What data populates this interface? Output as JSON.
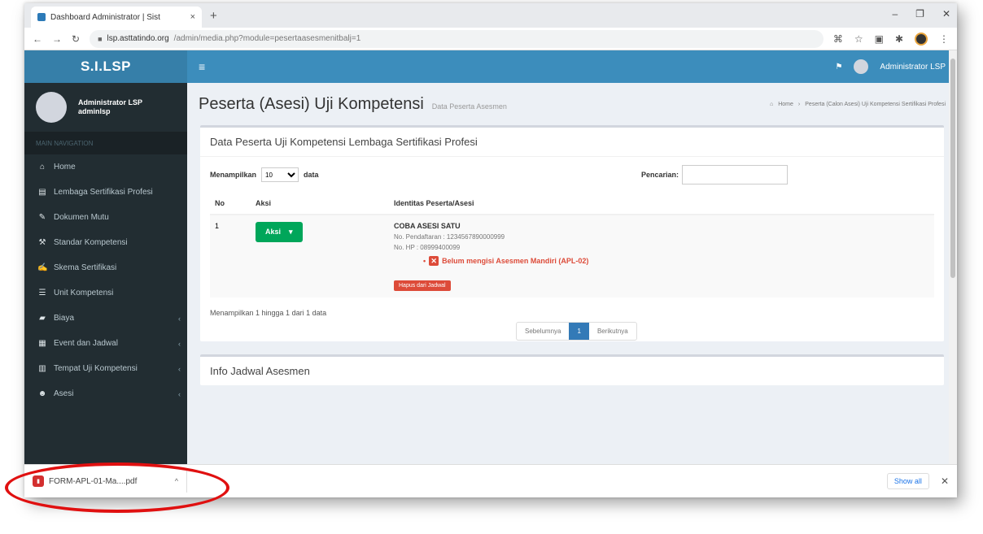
{
  "browser": {
    "tab_title": "Dashboard Administrator | Sist",
    "tab_close": "×",
    "new_tab": "+",
    "url_domain": "lsp.asttatindo.org",
    "url_path": "/admin/media.php?module=pesertaasesmenitbalj=1",
    "win_min": "–",
    "win_max": "❐",
    "win_close": "✕"
  },
  "app": {
    "logo": "S.I.LSP",
    "user_name": "Administrator LSP",
    "user_login": "adminlsp",
    "nav_header": "MAIN NAVIGATION",
    "nav": [
      {
        "icon": "home-icon",
        "glyph": "⌂",
        "label": "Home"
      },
      {
        "icon": "institution-icon",
        "glyph": "▤",
        "label": "Lembaga Sertifikasi Profesi"
      },
      {
        "icon": "document-icon",
        "glyph": "✎",
        "label": "Dokumen Mutu"
      },
      {
        "icon": "wrench-icon",
        "glyph": "⚒",
        "label": "Standar Kompetensi"
      },
      {
        "icon": "edit-icon",
        "glyph": "✍",
        "label": "Skema Sertifikasi"
      },
      {
        "icon": "list-icon",
        "glyph": "☰",
        "label": "Unit Kompetensi"
      },
      {
        "icon": "money-icon",
        "glyph": "▰",
        "label": "Biaya"
      },
      {
        "icon": "calendar-icon",
        "glyph": "▦",
        "label": "Event dan Jadwal"
      },
      {
        "icon": "building-icon",
        "glyph": "▥",
        "label": "Tempat Uji Kompetensi"
      },
      {
        "icon": "users-icon",
        "glyph": "☻",
        "label": "Asesi"
      }
    ],
    "topbar_user": "Administrator LSP"
  },
  "page": {
    "title": "Peserta (Asesi) Uji Kompetensi",
    "subtitle": "Data Peserta Asesmen",
    "breadcrumb_home": "Home",
    "breadcrumb_current": "Peserta (Calon Asesi) Uji Kompetensi Sertifikasi Profesi"
  },
  "table_box": {
    "title": "Data Peserta Uji Kompetensi Lembaga Sertifikasi Profesi",
    "show_label": "Menampilkan",
    "show_value": "10",
    "data_label": "data",
    "search_label": "Pencarian:",
    "headers": [
      "No",
      "Aksi",
      "Identitas Peserta/Asesi"
    ],
    "row": {
      "no": "1",
      "aksi_label": "Aksi",
      "name": "COBA ASESI SATU",
      "reg": "No. Pendaftaran : 1234567890000999",
      "phone": "No. HP : 08999400099",
      "warning": "Belum mengisi Asesmen Mandiri (APL-02)",
      "delete_label": "Hapus dari Jadwal"
    },
    "info": "Menampilkan 1 hingga 1 dari 1 data",
    "prev": "Sebelumnya",
    "page": "1",
    "next": "Berikutnya"
  },
  "info_box": {
    "title": "Info Jadwal Asesmen"
  },
  "download": {
    "filename": "FORM-APL-01-Ma....pdf",
    "show_all": "Show all"
  }
}
